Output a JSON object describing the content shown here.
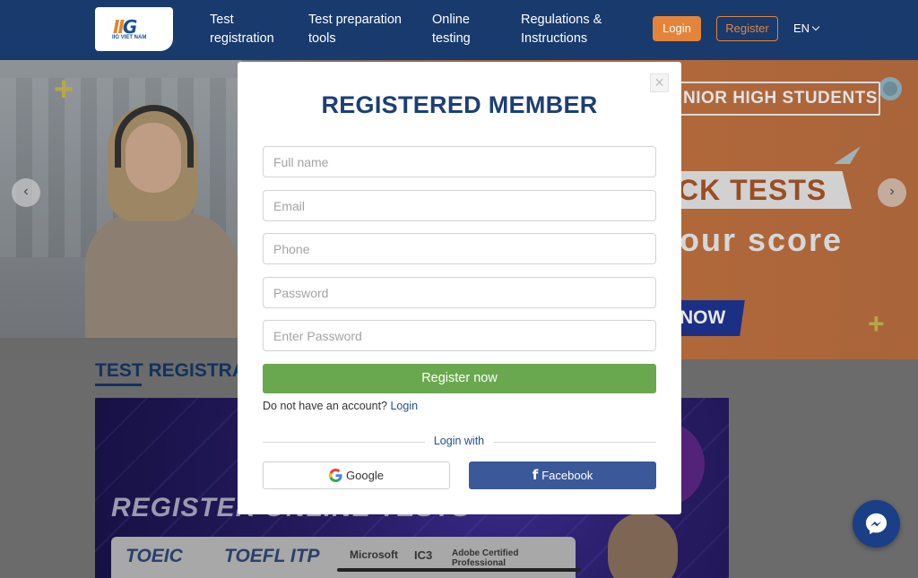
{
  "header": {
    "logo_text": "IIG VIET NAM",
    "nav": [
      {
        "line1": "Test",
        "line2": "registration"
      },
      {
        "line1": "Test preparation",
        "line2": "tools"
      },
      {
        "line1": "Online",
        "line2": "testing"
      },
      {
        "line1": "Regulations &",
        "line2": "Instructions"
      }
    ],
    "login_label": "Login",
    "register_label": "Register",
    "language": "EN"
  },
  "hero": {
    "tag": "NIOR HIGH STUDENTS",
    "ribbon": "CK TESTS",
    "score": "our score",
    "now": "NOW",
    "prev_arrow": "‹",
    "next_arrow": "›"
  },
  "section": {
    "title": "TEST REGISTRAT",
    "promo_title": "REGISTER ONLINE TESTS",
    "logos": [
      "TOEIC",
      "TOEFL ITP",
      "Microsoft",
      "IC3",
      "Adobe Certified Professional"
    ]
  },
  "modal": {
    "close": "×",
    "title": "REGISTERED MEMBER",
    "fields": [
      {
        "placeholder": "Full name"
      },
      {
        "placeholder": "Email"
      },
      {
        "placeholder": "Phone"
      },
      {
        "placeholder": "Password"
      },
      {
        "placeholder": "Enter Password"
      }
    ],
    "submit": "Register now",
    "no_account_text": "Do not have an account?",
    "no_account_link": "Login",
    "login_with": "Login with",
    "google": "Google",
    "facebook": "Facebook"
  },
  "colors": {
    "header_bg": "#183a6d",
    "accent_orange": "#e4843a",
    "title_blue": "#1c3f73",
    "submit_green": "#6aa84f",
    "facebook_blue": "#3b5998"
  }
}
